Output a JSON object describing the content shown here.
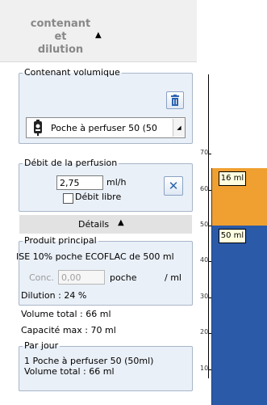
{
  "header": {
    "title": "contenant et dilution",
    "toggle_icon": "triangle-up-icon"
  },
  "contenant": {
    "legend": "Contenant volumique",
    "delete_icon": "trash-icon",
    "selected": "Poche à perfuser 50 (50"
  },
  "debit": {
    "legend": "Débit de la perfusion",
    "value": "2,75",
    "unit": "ml/h",
    "libre_label": "Débit libre",
    "clear_icon": "close-icon"
  },
  "details": {
    "label": "Détails",
    "toggle_icon": "triangle-up-icon"
  },
  "produit": {
    "legend": "Produit principal",
    "name": "ISE 10% poche ECOFLAC de 500 ml",
    "conc_label": "Conc.",
    "conc_value": "0,00",
    "conc_unit": "poche",
    "per_label": "/ ml",
    "dilution": "Dilution : 24 %"
  },
  "summary": {
    "volume_total": "Volume total : 66 ml",
    "capacite": "Capacité max : 70 ml"
  },
  "par_jour": {
    "legend": "Par jour",
    "line1": "1 Poche à perfuser 50 (50ml)",
    "line2": "Volume total : 66 ml"
  },
  "colors": {
    "orange": "#f0a030",
    "blue": "#2b5aa8",
    "panel_bg": "#eaf0f8"
  },
  "chart_data": {
    "type": "bar",
    "title": "",
    "xlabel": "",
    "ylabel": "",
    "ylim": [
      0,
      72
    ],
    "yticks": [
      10,
      20,
      30,
      40,
      50,
      60,
      70
    ],
    "categories": [
      ""
    ],
    "series": [
      {
        "values": [
          50
        ],
        "label": "50 ml",
        "color": "#2b5aa8"
      },
      {
        "values": [
          16
        ],
        "label": "16 ml",
        "color": "#f0a030"
      }
    ],
    "stacked": true,
    "grid": false
  }
}
